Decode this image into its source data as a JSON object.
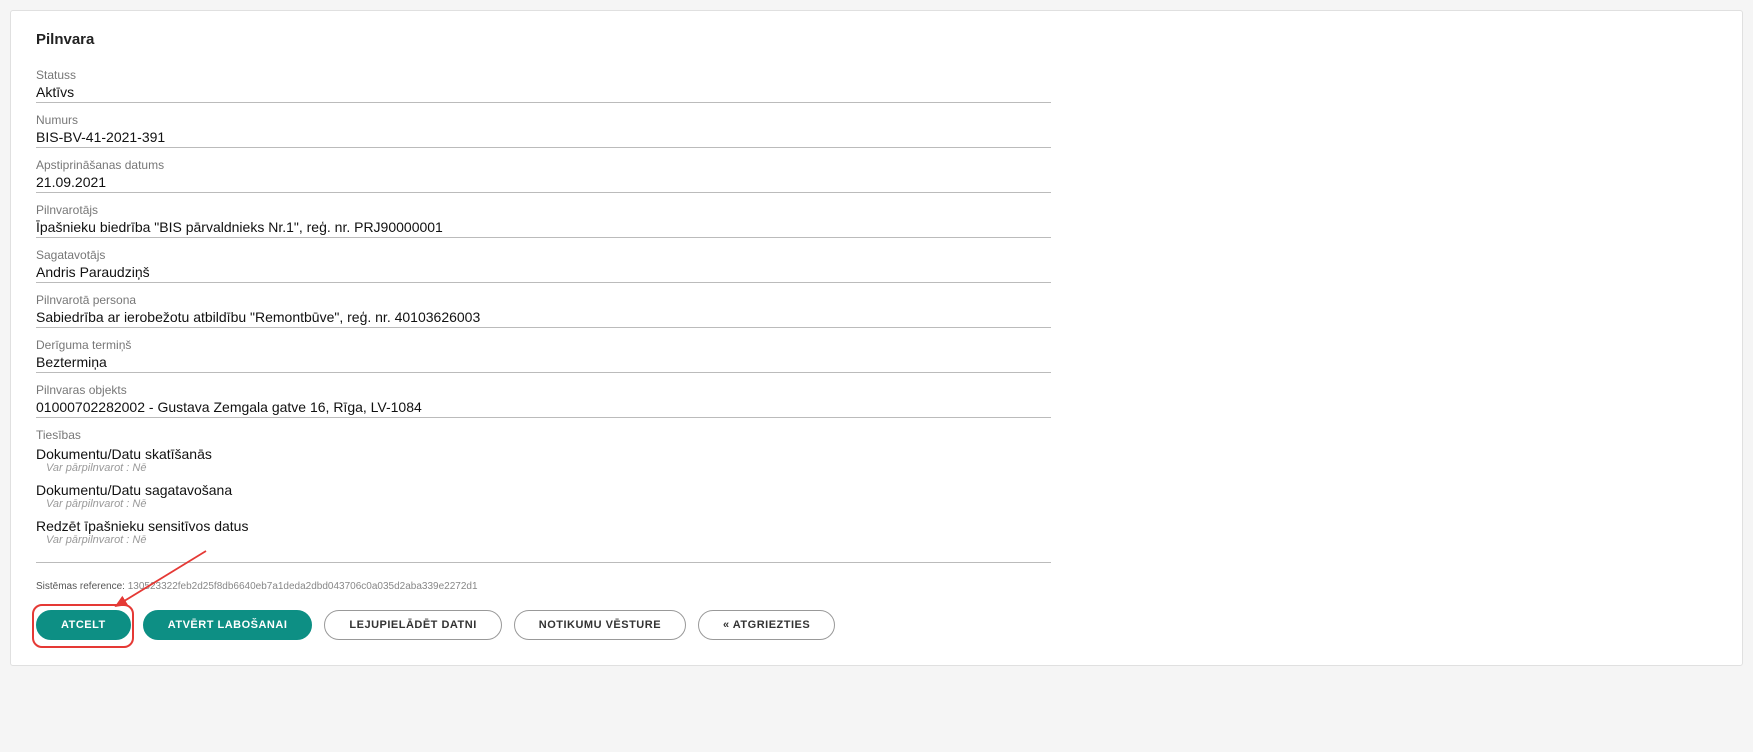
{
  "title": "Pilnvara",
  "fields": {
    "status": {
      "label": "Statuss",
      "value": "Aktīvs"
    },
    "number": {
      "label": "Numurs",
      "value": "BIS-BV-41-2021-391"
    },
    "approve_date": {
      "label": "Apstiprināšanas datums",
      "value": "21.09.2021"
    },
    "grantor": {
      "label": "Pilnvarotājs",
      "value": "Īpašnieku biedrība \"BIS pārvaldnieks Nr.1\", reģ. nr. PRJ90000001"
    },
    "preparer": {
      "label": "Sagatavotājs",
      "value": "Andris Paraudziņš"
    },
    "grantee": {
      "label": "Pilnvarotā persona",
      "value": "Sabiedrība ar ierobežotu atbildību \"Remontbūve\", reģ. nr. 40103626003"
    },
    "validity": {
      "label": "Derīguma termiņš",
      "value": "Beztermiņa"
    },
    "object": {
      "label": "Pilnvaras objekts",
      "value": "01000702282002 - Gustava Zemgala gatve 16, Rīga, LV-1084"
    }
  },
  "rights": {
    "label": "Tiesības",
    "items": [
      {
        "name": "Dokumentu/Datu skatīšanās",
        "sub": "Var pārpilnvarot : Nē"
      },
      {
        "name": "Dokumentu/Datu sagatavošana",
        "sub": "Var pārpilnvarot : Nē"
      },
      {
        "name": "Redzēt īpašnieku sensitīvos datus",
        "sub": "Var pārpilnvarot : Nē"
      }
    ]
  },
  "sysref": {
    "label": "Sistēmas reference:",
    "value": "130523322feb2d25f8db6640eb7a1deda2dbd043706c0a035d2aba339e2272d1"
  },
  "buttons": {
    "cancel": "ATCELT",
    "edit": "ATVĒRT LABOŠANAI",
    "download": "LEJUPIELĀDĒT DATNI",
    "history": "NOTIKUMU VĒSTURE",
    "back": "« ATGRIEZTIES"
  }
}
